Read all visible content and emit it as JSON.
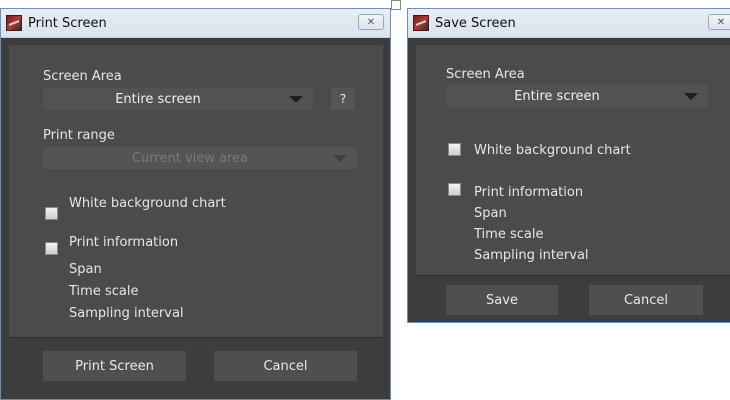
{
  "print_dialog": {
    "title": "Print Screen",
    "close_glyph": "✕",
    "screen_area_label": "Screen Area",
    "screen_area_value": "Entire screen",
    "help_label": "?",
    "print_range_label": "Print range",
    "print_range_value": "Current view area",
    "white_bg_label": "White background chart",
    "print_info_label": "Print information",
    "info_items": [
      "Span",
      "Time scale",
      "Sampling interval"
    ],
    "ok_button": "Print Screen",
    "cancel_button": "Cancel"
  },
  "save_dialog": {
    "title": "Save Screen",
    "close_glyph": "✕",
    "screen_area_label": "Screen Area",
    "screen_area_value": "Entire screen",
    "white_bg_label": "White background chart",
    "print_info_label": "Print information",
    "info_items": [
      "Span",
      "Time scale",
      "Sampling interval"
    ],
    "ok_button": "Save",
    "cancel_button": "Cancel"
  }
}
